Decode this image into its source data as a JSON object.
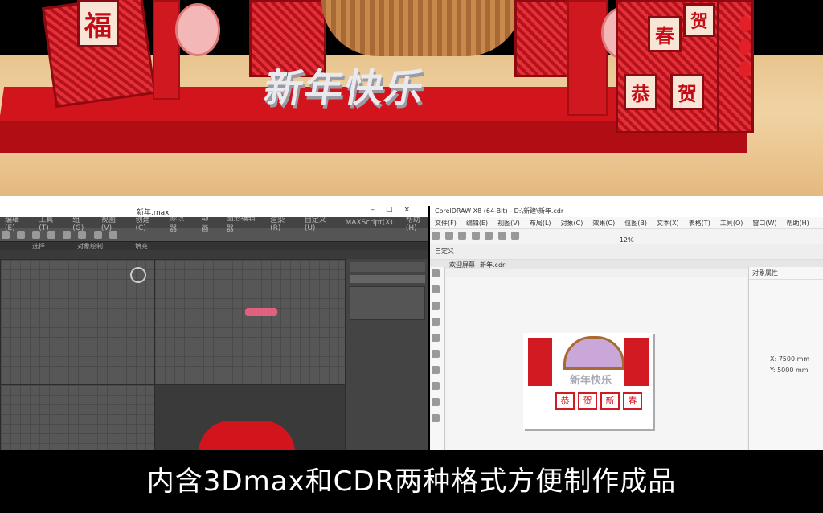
{
  "scene": {
    "title_3d": "新年快乐",
    "cube_char": "福",
    "panel_chars": [
      "春",
      "贺",
      "恭",
      "贺"
    ]
  },
  "max": {
    "window_title": "新年.max",
    "menu": [
      "编辑(E)",
      "工具(T)",
      "组(G)",
      "视图(V)",
      "创建(C)",
      "修改器",
      "动画",
      "图形编辑器",
      "渲染(R)",
      "自定义(U)",
      "MAXScript(X)",
      "帮助(H)"
    ],
    "tabs": [
      "选择",
      "对象绘制",
      "填充"
    ]
  },
  "cdr": {
    "window_title": "CorelDRAW X8 (64-Bit) - D:\\新建\\新年.cdr",
    "menu": [
      "文件(F)",
      "编辑(E)",
      "视图(V)",
      "布局(L)",
      "对象(C)",
      "效果(C)",
      "位图(B)",
      "文本(X)",
      "表格(T)",
      "工具(O)",
      "窗口(W)",
      "帮助(H)"
    ],
    "tabs": [
      "欢迎屏幕",
      "新年.cdr"
    ],
    "zoom": "12%",
    "page_size": "自定义",
    "docker_title": "对象属性",
    "docker_x": "X: 7500 mm",
    "docker_y": "Y: 5000 mm",
    "design_title": "新年快乐",
    "design_seals": [
      "恭",
      "贺",
      "新",
      "春"
    ]
  },
  "caption": "内含3Dmax和CDR两种格式方便制作成品"
}
